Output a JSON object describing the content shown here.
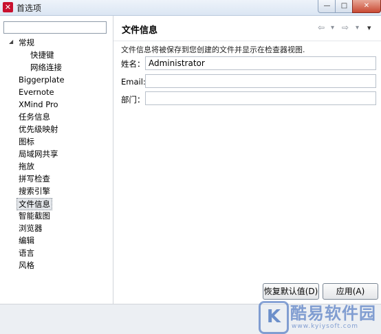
{
  "window": {
    "app_icon": "xmind-logo-icon",
    "title": "首选项",
    "minimize_glyph": "—",
    "maximize_glyph": "□",
    "close_glyph": "✕"
  },
  "sidebar": {
    "filter_value": "",
    "items": [
      {
        "label": "常规",
        "expanded": true
      },
      {
        "label": "快捷键"
      },
      {
        "label": "网络连接"
      },
      {
        "label": "Biggerplate"
      },
      {
        "label": "Evernote"
      },
      {
        "label": "XMind Pro"
      },
      {
        "label": "任务信息"
      },
      {
        "label": "优先级映射"
      },
      {
        "label": "图标"
      },
      {
        "label": "局域网共享"
      },
      {
        "label": "拖放"
      },
      {
        "label": "拼写检查"
      },
      {
        "label": "搜索引擎"
      },
      {
        "label": "文件信息",
        "selected": true
      },
      {
        "label": "智能截图"
      },
      {
        "label": "浏览器"
      },
      {
        "label": "编辑"
      },
      {
        "label": "语言"
      },
      {
        "label": "风格"
      }
    ]
  },
  "main": {
    "title": "文件信息",
    "nav": {
      "back": "⇦",
      "back_menu": "▾",
      "forward": "⇨",
      "forward_menu": "▾",
      "view_menu": "▾"
    },
    "description": "文件信息将被保存到您创建的文件并显示在检查器视图.",
    "fields": [
      {
        "label": "姓名：",
        "value": "Administrator"
      },
      {
        "label": "Email:",
        "value": ""
      },
      {
        "label": "部门：",
        "value": ""
      }
    ],
    "restore_defaults_label": "恢复默认值(D)",
    "apply_label": "应用(A)"
  },
  "watermark": {
    "mark": "K",
    "text": "酷易软件园",
    "url": "www.kyiysoft.com"
  }
}
